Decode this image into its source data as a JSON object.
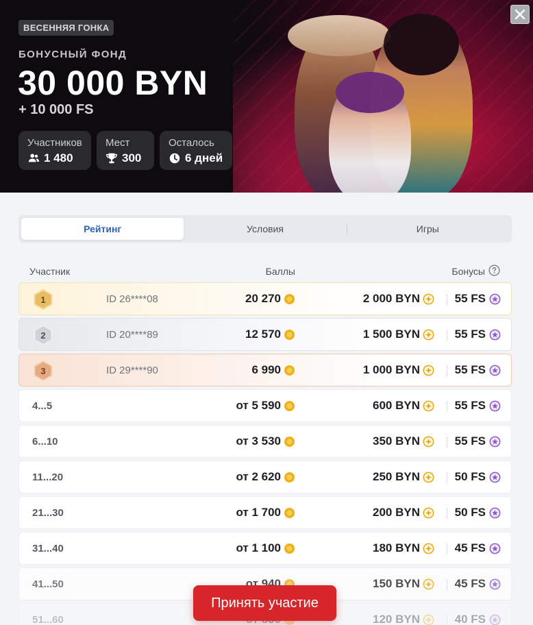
{
  "hero": {
    "tag": "ВЕСЕННЯЯ ГОНКА",
    "fund_label": "БОНУСНЫЙ ФОНД",
    "fund_amount": "30 000 BYN",
    "fund_extra": "+ 10 000 FS",
    "stats": [
      {
        "label": "Участников",
        "value": "1 480",
        "icon": "users-icon"
      },
      {
        "label": "Мест",
        "value": "300",
        "icon": "trophy-icon"
      },
      {
        "label": "Осталось",
        "value": "6 дней",
        "icon": "clock-icon"
      }
    ]
  },
  "tabs": [
    {
      "label": "Рейтинг",
      "active": true
    },
    {
      "label": "Условия",
      "active": false
    },
    {
      "label": "Игры",
      "active": false
    }
  ],
  "table": {
    "headers": {
      "participant": "Участник",
      "points": "Баллы",
      "bonuses": "Бонусы"
    },
    "top_rows": [
      {
        "place": "1",
        "id": "ID 26****08",
        "points": "20 270",
        "byn": "2 000 BYN",
        "fs": "55 FS"
      },
      {
        "place": "2",
        "id": "ID 20****89",
        "points": "12 570",
        "byn": "1 500 BYN",
        "fs": "55 FS"
      },
      {
        "place": "3",
        "id": "ID 29****90",
        "points": "6 990",
        "byn": "1 000 BYN",
        "fs": "55 FS"
      }
    ],
    "range_rows": [
      {
        "range": "4...5",
        "points": "от 5 590",
        "byn": "600 BYN",
        "fs": "55 FS"
      },
      {
        "range": "6...10",
        "points": "от 3 530",
        "byn": "350 BYN",
        "fs": "55 FS"
      },
      {
        "range": "11...20",
        "points": "от 2 620",
        "byn": "250 BYN",
        "fs": "50 FS"
      },
      {
        "range": "21...30",
        "points": "от 1 700",
        "byn": "200 BYN",
        "fs": "50 FS"
      },
      {
        "range": "31...40",
        "points": "от 1 100",
        "byn": "180 BYN",
        "fs": "45 FS"
      },
      {
        "range": "41...50",
        "points": "от 940",
        "byn": "150 BYN",
        "fs": "45 FS"
      },
      {
        "range": "51...60",
        "points": "от 850",
        "byn": "120 BYN",
        "fs": "40 FS"
      }
    ]
  },
  "cta_label": "Принять участие",
  "colors": {
    "accent": "#2e63b8",
    "cta": "#d6262b",
    "gold": "#e2b25c",
    "silver": "#bfc3c9",
    "bronze": "#e0a27a",
    "coin": "#f2b51f",
    "fs_badge": "#8a5bc6"
  }
}
